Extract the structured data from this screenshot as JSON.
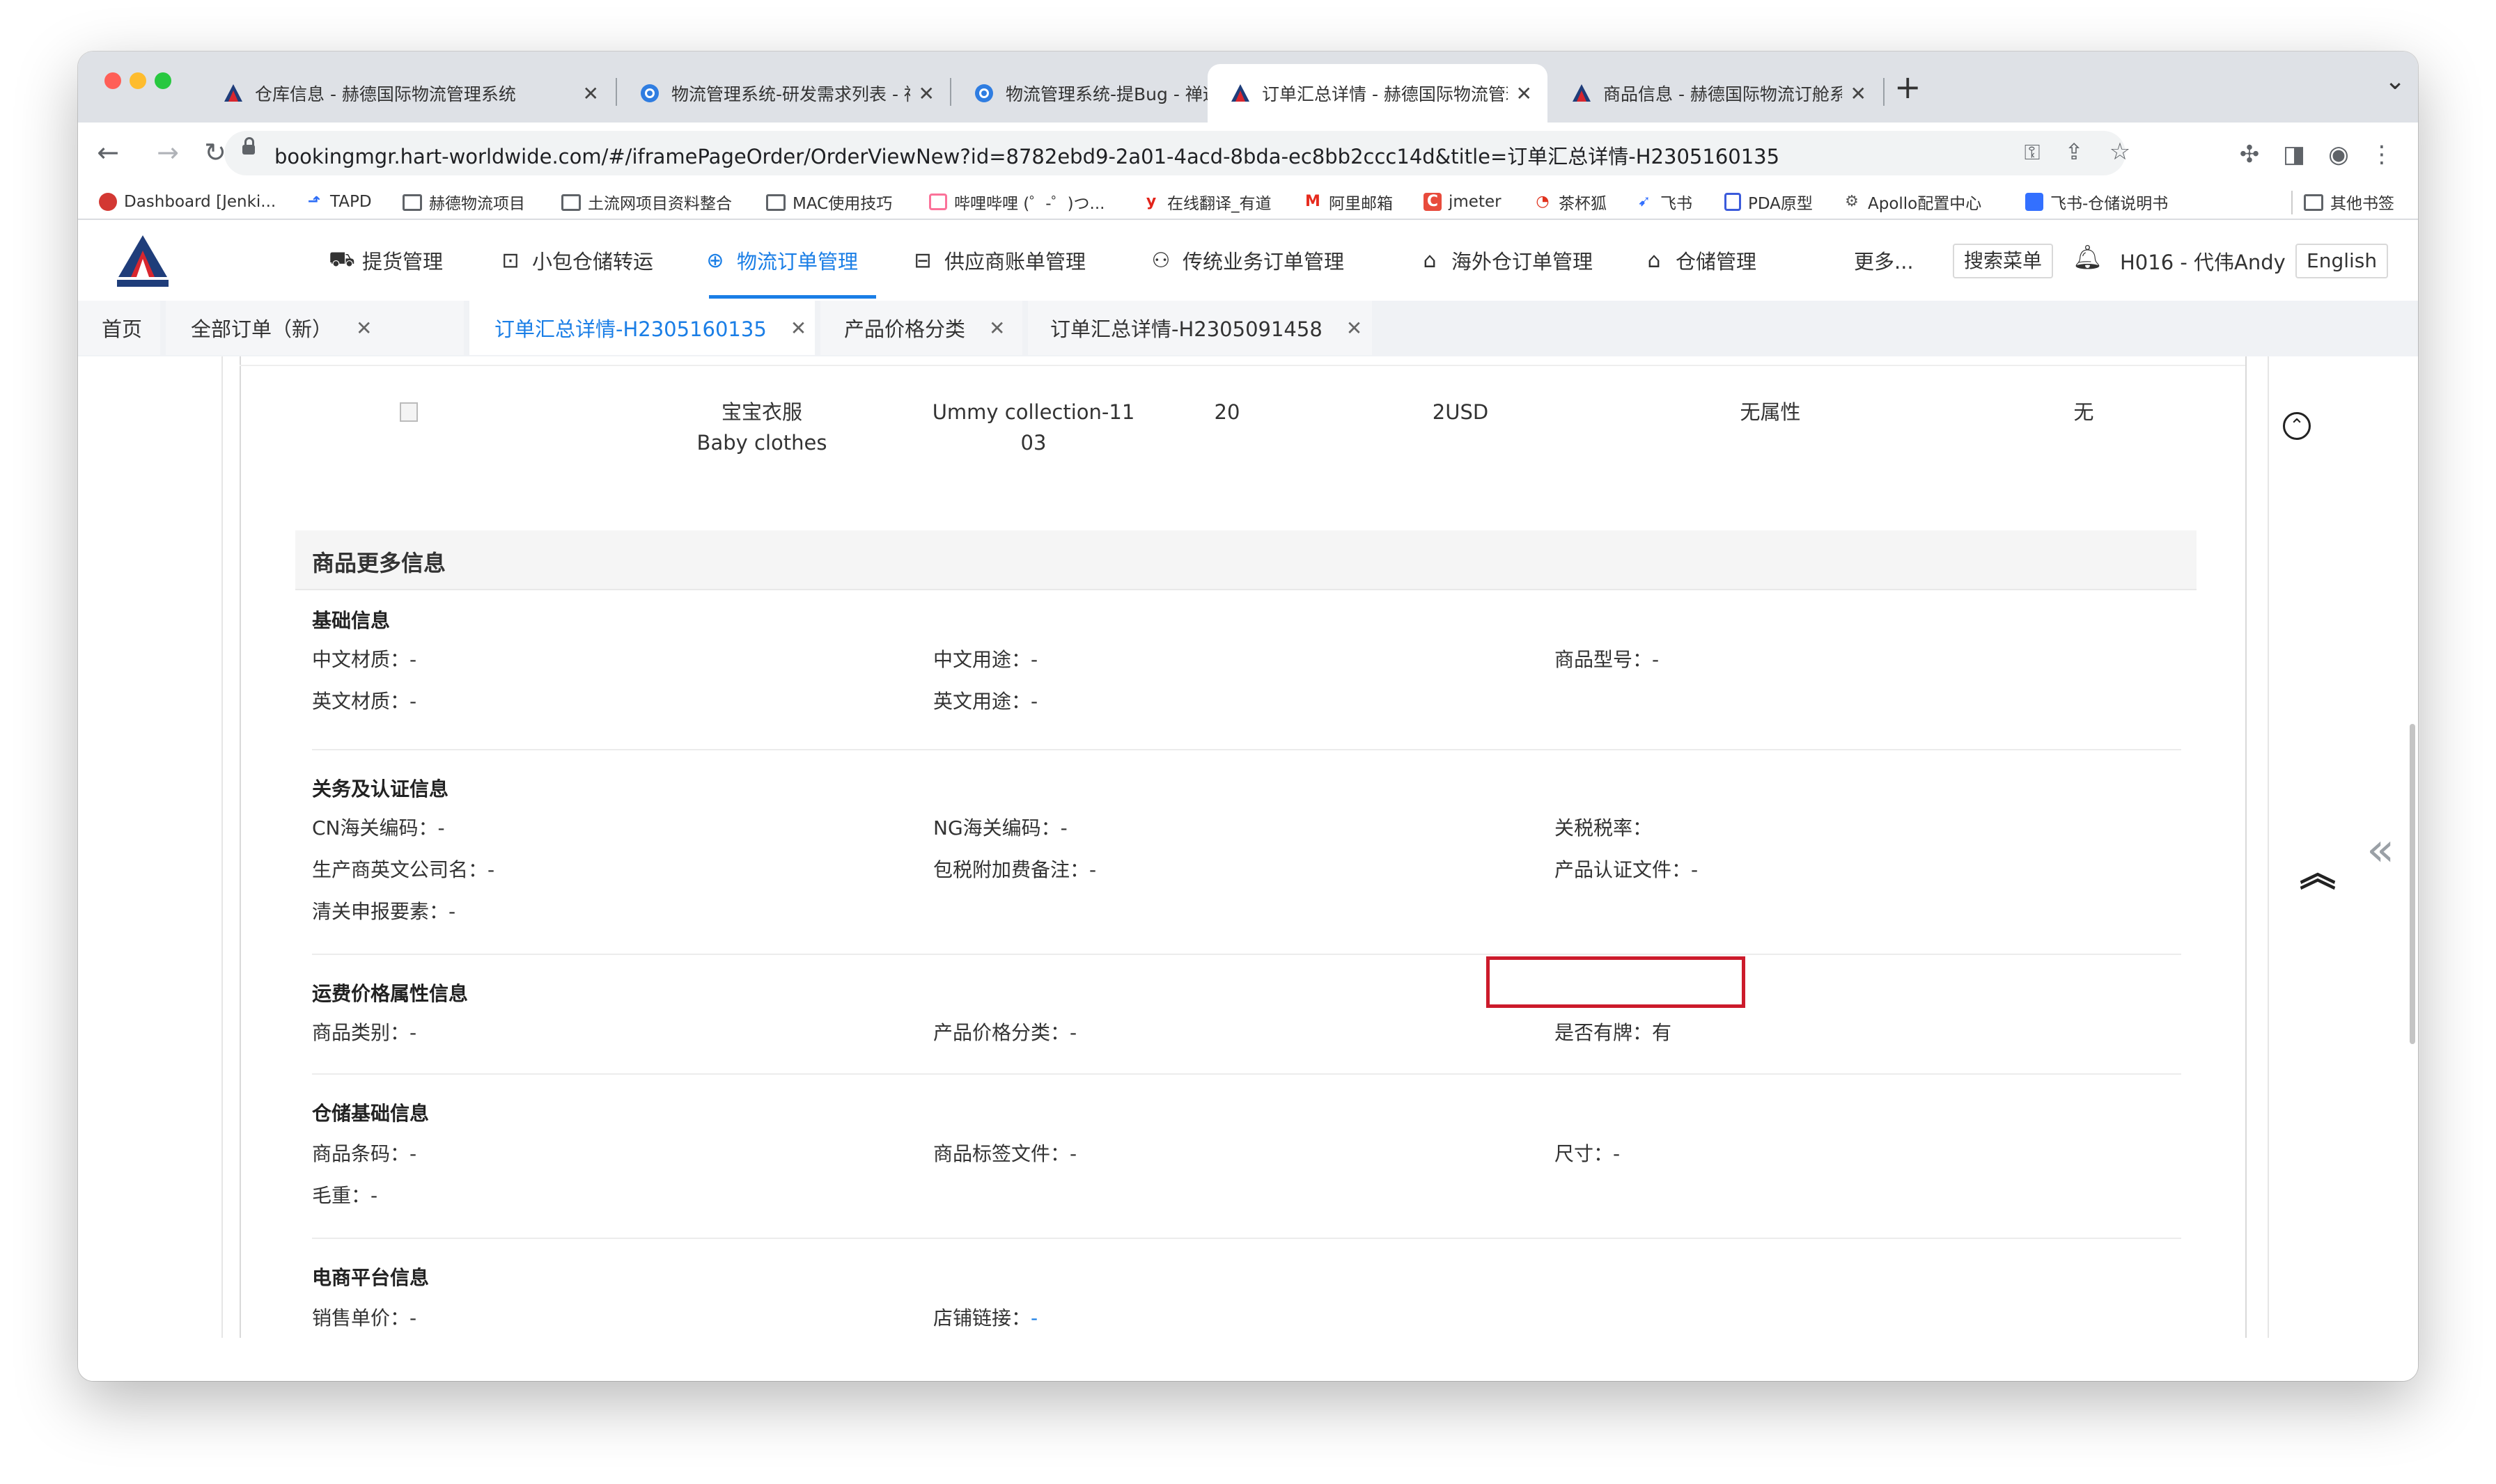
{
  "browser": {
    "tabs": [
      {
        "title": "仓库信息 - 赫德国际物流管理系统",
        "icon": "hart-logo-icon",
        "active": false
      },
      {
        "title": "物流管理系统-研发需求列表 - 禅道",
        "icon": "zentao-icon",
        "active": false
      },
      {
        "title": "物流管理系统-提Bug - 禅道",
        "icon": "zentao-icon",
        "active": false
      },
      {
        "title": "订单汇总详情 - 赫德国际物流管理系统",
        "icon": "hart-logo-icon",
        "active": true
      },
      {
        "title": "商品信息 - 赫德国际物流订舱系统",
        "icon": "hart-logo-icon",
        "active": false
      }
    ],
    "new_tab": "+",
    "tab_menu": "⌄",
    "url": "bookingmgr.hart-worldwide.com/#/iframePageOrder/OrderViewNew?id=8782ebd9-2a01-4acd-8bda-ec8bb2ccc14d&title=订单汇总详情-H2305160135",
    "bookmarks": [
      {
        "label": "Dashboard [Jenki...",
        "icon": "jenkins-icon"
      },
      {
        "label": "TAPD",
        "icon": "tapd-icon"
      },
      {
        "label": "赫德物流项目",
        "icon": "folder-icon"
      },
      {
        "label": "土流网项目资料整合",
        "icon": "folder-icon"
      },
      {
        "label": "MAC使用技巧",
        "icon": "folder-icon"
      },
      {
        "label": "哔哩哔哩 (゜-゜)つ...",
        "icon": "bilibili-icon"
      },
      {
        "label": "在线翻译_有道",
        "icon": "youdao-icon"
      },
      {
        "label": "阿里邮箱",
        "icon": "alimail-icon"
      },
      {
        "label": "jmeter",
        "icon": "jmeter-icon"
      },
      {
        "label": "茶杯狐",
        "icon": "cupfox-icon"
      },
      {
        "label": "飞书",
        "icon": "feishu-icon"
      },
      {
        "label": "PDA原型",
        "icon": "pda-icon"
      },
      {
        "label": "Apollo配置中心",
        "icon": "apollo-icon"
      },
      {
        "label": "飞书-仓储说明书",
        "icon": "doc-icon"
      }
    ],
    "other_bookmarks": "其他书签"
  },
  "app": {
    "menu": [
      {
        "label": "提货管理",
        "icon": "truck-icon",
        "active": false
      },
      {
        "label": "小包仓储转运",
        "icon": "box-icon",
        "active": false
      },
      {
        "label": "物流订单管理",
        "icon": "globe-icon",
        "active": true
      },
      {
        "label": "供应商账单管理",
        "icon": "bill-icon",
        "active": false
      },
      {
        "label": "传统业务订单管理",
        "icon": "network-icon",
        "active": false
      },
      {
        "label": "海外仓订单管理",
        "icon": "home-icon",
        "active": false
      },
      {
        "label": "仓储管理",
        "icon": "house-filled-icon",
        "active": false
      },
      {
        "label": "更多...",
        "icon": "",
        "active": false
      }
    ],
    "search_menu": "搜索菜单",
    "user": "H016 - 代伟Andy",
    "language": "English",
    "tabs": [
      {
        "label": "首页",
        "closable": false,
        "active": false
      },
      {
        "label": "全部订单（新）",
        "closable": true,
        "active": false
      },
      {
        "label": "订单汇总详情-H2305160135",
        "closable": true,
        "active": true
      },
      {
        "label": "产品价格分类",
        "closable": true,
        "active": false
      },
      {
        "label": "订单汇总详情-H2305091458",
        "closable": true,
        "active": false
      }
    ]
  },
  "product_row": {
    "name_cn": "宝宝衣服",
    "name_en": "Baby clothes",
    "collection": "Ummy collection-1103",
    "quantity": "20",
    "price": "2USD",
    "attribute": "无属性",
    "remark": "无"
  },
  "more_info": {
    "title": "商品更多信息",
    "groups": {
      "basic": {
        "title": "基础信息",
        "cn_material": "中文材质：-",
        "cn_usage": "中文用途：-",
        "model": "商品型号：-",
        "en_material": "英文材质：-",
        "en_usage": "英文用途：-"
      },
      "customs": {
        "title": "关务及认证信息",
        "cn_hs": "CN海关编码：-",
        "ng_hs": "NG海关编码：-",
        "tariff": "关税税率：",
        "manufacturer": "生产商英文公司名：-",
        "tax_fee_note": "包税附加费备注：-",
        "cert_file": "产品认证文件：-",
        "declaration": "清关申报要素：-"
      },
      "freight": {
        "title": "运费价格属性信息",
        "category": "商品类别：-",
        "price_class": "产品价格分类：-",
        "branded": "是否有牌：有"
      },
      "warehouse": {
        "title": "仓储基础信息",
        "barcode": "商品条码：-",
        "label_file": "商品标签文件：-",
        "size": "尺寸：-",
        "gross_weight": "毛重：-"
      },
      "ecommerce": {
        "title": "电商平台信息",
        "unit_price": "销售单价：-",
        "store_link_label": "店铺链接：",
        "store_link_value": "-"
      }
    }
  },
  "colors": {
    "accent": "#1a7ee6",
    "highlight_box": "#cc1b2b",
    "tab_strip": "#dee1e6"
  }
}
